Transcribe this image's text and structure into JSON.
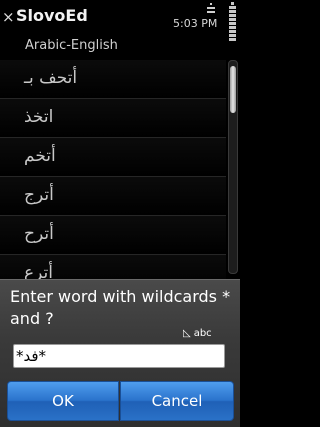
{
  "header": {
    "app_title": "SlovoEd",
    "time": "5:03 PM",
    "close_glyph": "×",
    "subtitle": "Arabic-English"
  },
  "list": {
    "items": [
      "أتحف بـ",
      "اتخذ",
      "أتخم",
      "أترج",
      "أترح",
      "أترع"
    ],
    "scroll_position": 0.03,
    "scroll_visible_fraction": 0.22
  },
  "dialog": {
    "title": "Enter word with wildcards * and ?",
    "input_mode": "abc",
    "input_value": "*فد*",
    "ok_label": "OK",
    "cancel_label": "Cancel"
  },
  "colors": {
    "background": "#000000",
    "dialog_bg": "#3a3a3a",
    "button_blue": "#2a73cc"
  }
}
